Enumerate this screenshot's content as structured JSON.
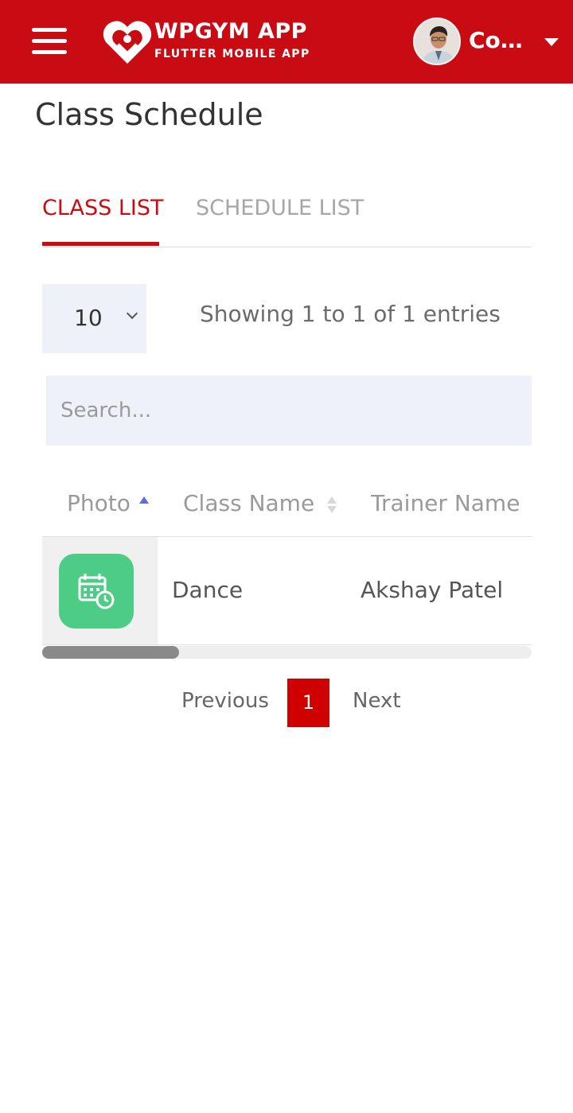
{
  "header": {
    "brand_title": "WPGYM APP",
    "brand_subtitle": "FLUTTER MOBILE APP",
    "user_name": "Con...",
    "colors": {
      "bar": "#c90b14",
      "text": "#ffffff"
    },
    "icons": {
      "menu": "hamburger-menu-icon",
      "logo": "heart-logo-icon",
      "dropdown": "caret-down-icon"
    }
  },
  "page": {
    "title": "Class Schedule"
  },
  "tabs": [
    {
      "label": "CLASS LIST",
      "active": true
    },
    {
      "label": "SCHEDULE LIST",
      "active": false
    }
  ],
  "table_controls": {
    "page_length": "10",
    "info": "Showing 1 to 1 of 1 entries",
    "search_placeholder": "Search..."
  },
  "table": {
    "columns": [
      "Photo",
      "Class Name",
      "Trainer Name"
    ],
    "sort": {
      "column": "Photo",
      "direction": "asc"
    },
    "rows": [
      {
        "photo_icon": "calendar-clock-icon",
        "class_name": "Dance",
        "trainer_name": "Akshay Patel"
      }
    ],
    "horizontal_scroll_visible_fraction": 0.28
  },
  "pagination": {
    "previous": "Previous",
    "current_page": "1",
    "next": "Next"
  },
  "colors": {
    "accent": "#c90b14",
    "class_icon_bg": "#4dcc86",
    "page_active": "#d00000"
  }
}
